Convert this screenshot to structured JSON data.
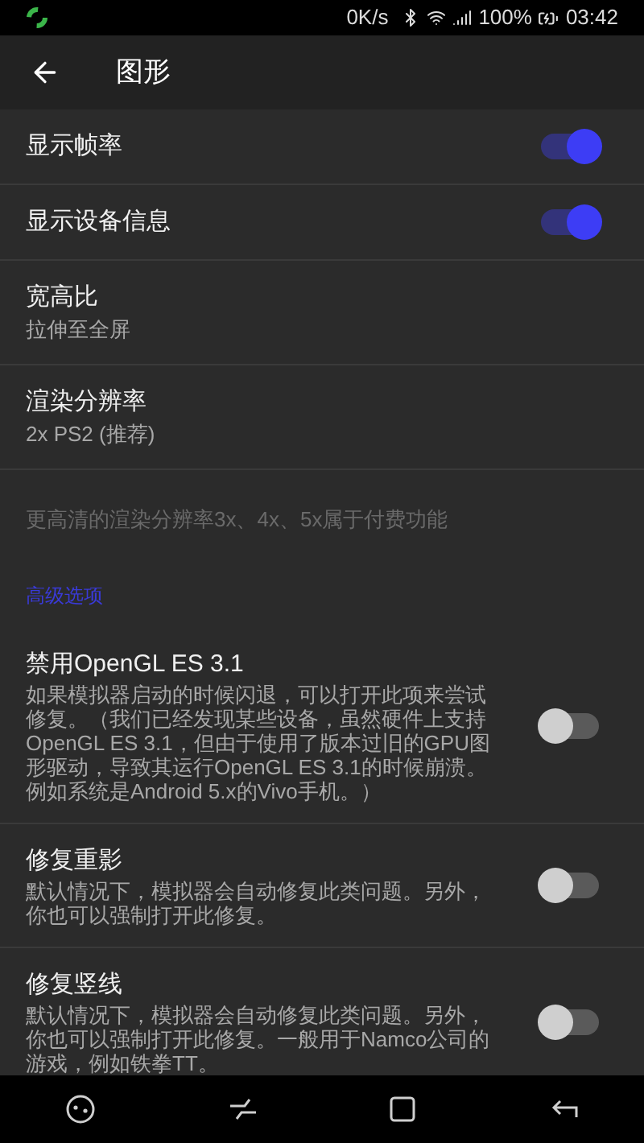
{
  "status_bar": {
    "speed": "0K/s",
    "battery": "100%",
    "time": "03:42"
  },
  "toolbar": {
    "title": "图形"
  },
  "settings": [
    {
      "kind": "toggle",
      "title": "显示帧率",
      "on": true
    },
    {
      "kind": "toggle",
      "title": "显示设备信息",
      "on": true
    },
    {
      "kind": "value",
      "title": "宽高比",
      "value": "拉伸至全屏"
    },
    {
      "kind": "value",
      "title": "渲染分辨率",
      "value": "2x PS2 (推荐)"
    },
    {
      "kind": "note",
      "text": "更高清的渲染分辨率3x、4x、5x属于付费功能"
    },
    {
      "kind": "header",
      "text": "高级选项"
    },
    {
      "kind": "toggle",
      "title": "禁用OpenGL ES 3.1",
      "description": "如果模拟器启动的时候闪退，可以打开此项来尝试修复。（我们已经发现某些设备，虽然硬件上支持OpenGL ES 3.1，但由于使用了版本过旧的GPU图形驱动，导致其运行OpenGL ES 3.1的时候崩溃。例如系统是Android 5.x的Vivo手机。）",
      "on": false
    },
    {
      "kind": "toggle",
      "title": "修复重影",
      "description": "默认情况下，模拟器会自动修复此类问题。另外，你也可以强制打开此修复。",
      "on": false
    },
    {
      "kind": "toggle",
      "title": "修复竖线",
      "description": "默认情况下，模拟器会自动修复此类问题。另外，你也可以强制打开此修复。一般用于Namco公司的游戏，例如铁拳TT。",
      "on": false
    }
  ]
}
